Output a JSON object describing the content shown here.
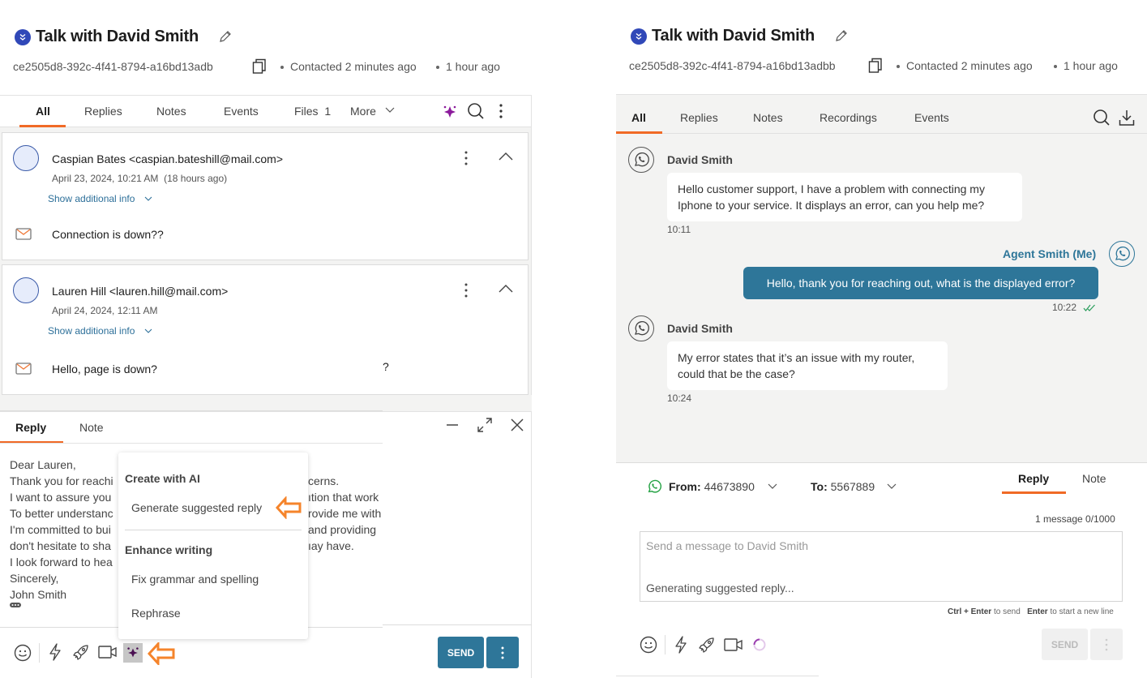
{
  "left": {
    "title": "Talk with David Smith",
    "conversation_id": "ce2505d8-392c-4f41-8794-a16bd13adb",
    "contacted": "Contacted 2 minutes ago",
    "age": "1 hour ago",
    "tabs": [
      {
        "label": "All",
        "active": true
      },
      {
        "label": "Replies"
      },
      {
        "label": "Notes"
      },
      {
        "label": "Events"
      },
      {
        "label": "Files",
        "count": "1"
      },
      {
        "label": "More"
      }
    ],
    "emails": [
      {
        "sender": "Caspian Bates <caspian.bateshill@mail.com>",
        "date": "April 23, 2024, 10:21 AM  (18 hours ago)",
        "show_info": "Show additional info",
        "body": "Connection is down??"
      },
      {
        "sender": "Lauren Hill <lauren.hill@mail.com>",
        "date": "April 24, 2024, 12:11 AM",
        "show_info": "Show additional info",
        "body": "Hello, page is down?",
        "overflow_char": "?"
      }
    ],
    "composer": {
      "tabs": [
        {
          "label": "Reply",
          "active": true
        },
        {
          "label": "Note"
        }
      ],
      "lines": [
        "Dear Lauren,",
        "Thank you for reachi",
        "I want to assure you",
        "To better understanc",
        "I'm committed to bui",
        "don't hesitate to sha",
        "I look forward to hea",
        "Sincerely,",
        "John Smith"
      ],
      "lines_right": [
        "cerns.",
        "ıtion that work",
        "rovide me with",
        "and providing",
        "ıay have."
      ],
      "send_label": "SEND"
    },
    "ai_menu": {
      "section1": "Create with AI",
      "item1": "Generate suggested reply",
      "section2": "Enhance writing",
      "item2": "Fix grammar and spelling",
      "item3": "Rephrase"
    },
    "accent_color": "#f06a26",
    "send_color": "#2e7699"
  },
  "right": {
    "title": "Talk with David Smith",
    "conversation_id": "ce2505d8-392c-4f41-8794-a16bd13adbb",
    "contacted": "Contacted 2 minutes ago",
    "age": "1 hour ago",
    "tabs": [
      {
        "label": "All",
        "active": true
      },
      {
        "label": "Replies"
      },
      {
        "label": "Notes"
      },
      {
        "label": "Recordings"
      },
      {
        "label": "Events"
      }
    ],
    "messages": [
      {
        "sender": "David Smith",
        "text_1": "Hello customer support, I have a problem with connecting my",
        "text_2": "Iphone to your service. It displays an error, can you help me?",
        "time": "10:11"
      },
      {
        "sender": "Agent Smith (Me)",
        "text_1": "Hello, thank you for reaching out, what is the displayed error?",
        "time": "10:22"
      },
      {
        "sender": "David Smith",
        "text_1": "My error states that it’s an issue with my router,",
        "text_2": "could that be the case?",
        "time": "10:24"
      }
    ],
    "from_label": "From:",
    "from_value": "44673890",
    "to_label": "To:",
    "to_value": "5567889",
    "composer_tabs": [
      {
        "label": "Reply",
        "active": true
      },
      {
        "label": "Note"
      }
    ],
    "counter": "1 message 0/1000",
    "placeholder": "Send a message to David Smith",
    "status": "Generating suggested reply...",
    "hint_key1": "Ctrl + Enter",
    "hint_text1": " to send",
    "hint_key2": "Enter",
    "hint_text2": " to start a new line",
    "send_label": "SEND"
  }
}
